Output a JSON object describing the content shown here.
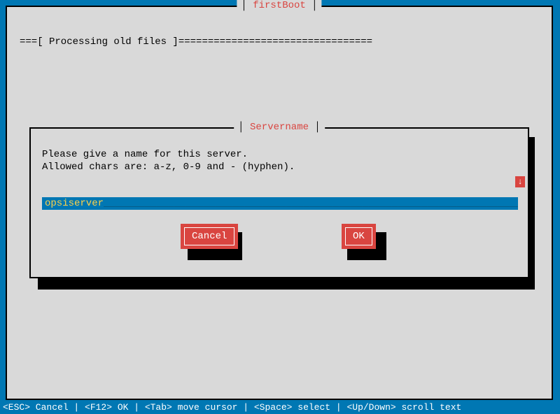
{
  "outer": {
    "title": "firstBoot",
    "processing": "===[ Processing old files ]================================="
  },
  "dialog": {
    "title": "Servername",
    "prompt_line1": "Please give a name for this server.",
    "prompt_line2": "Allowed chars are: a-z, 0-9 and - (hyphen).",
    "scroll_arrow": "↓",
    "input_value": "opsiserver",
    "buttons": {
      "cancel": "Cancel",
      "ok": "OK"
    }
  },
  "footer": {
    "text": "<ESC> Cancel  |  <F12> OK  |  <Tab> move cursor  |  <Space> select  |  <Up/Down> scroll text"
  }
}
